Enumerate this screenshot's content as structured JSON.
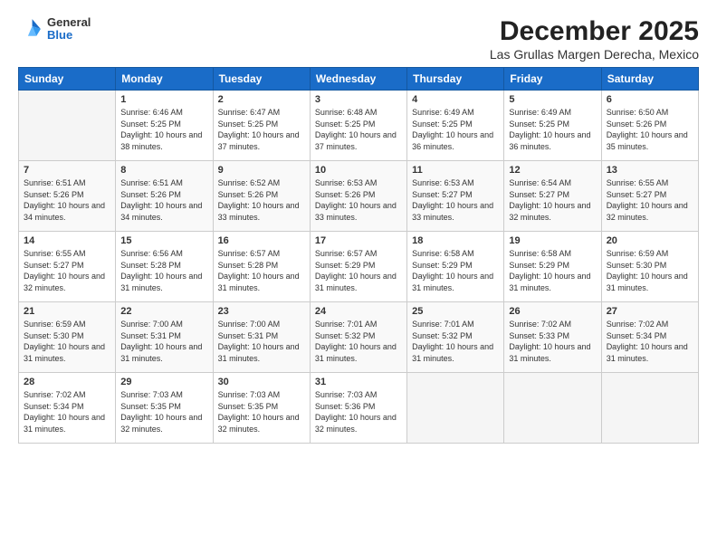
{
  "logo": {
    "general": "General",
    "blue": "Blue"
  },
  "title": "December 2025",
  "location": "Las Grullas Margen Derecha, Mexico",
  "days_header": [
    "Sunday",
    "Monday",
    "Tuesday",
    "Wednesday",
    "Thursday",
    "Friday",
    "Saturday"
  ],
  "weeks": [
    [
      {
        "day": "",
        "sunrise": "",
        "sunset": "",
        "daylight": ""
      },
      {
        "day": "1",
        "sunrise": "Sunrise: 6:46 AM",
        "sunset": "Sunset: 5:25 PM",
        "daylight": "Daylight: 10 hours and 38 minutes."
      },
      {
        "day": "2",
        "sunrise": "Sunrise: 6:47 AM",
        "sunset": "Sunset: 5:25 PM",
        "daylight": "Daylight: 10 hours and 37 minutes."
      },
      {
        "day": "3",
        "sunrise": "Sunrise: 6:48 AM",
        "sunset": "Sunset: 5:25 PM",
        "daylight": "Daylight: 10 hours and 37 minutes."
      },
      {
        "day": "4",
        "sunrise": "Sunrise: 6:49 AM",
        "sunset": "Sunset: 5:25 PM",
        "daylight": "Daylight: 10 hours and 36 minutes."
      },
      {
        "day": "5",
        "sunrise": "Sunrise: 6:49 AM",
        "sunset": "Sunset: 5:25 PM",
        "daylight": "Daylight: 10 hours and 36 minutes."
      },
      {
        "day": "6",
        "sunrise": "Sunrise: 6:50 AM",
        "sunset": "Sunset: 5:26 PM",
        "daylight": "Daylight: 10 hours and 35 minutes."
      }
    ],
    [
      {
        "day": "7",
        "sunrise": "Sunrise: 6:51 AM",
        "sunset": "Sunset: 5:26 PM",
        "daylight": "Daylight: 10 hours and 34 minutes."
      },
      {
        "day": "8",
        "sunrise": "Sunrise: 6:51 AM",
        "sunset": "Sunset: 5:26 PM",
        "daylight": "Daylight: 10 hours and 34 minutes."
      },
      {
        "day": "9",
        "sunrise": "Sunrise: 6:52 AM",
        "sunset": "Sunset: 5:26 PM",
        "daylight": "Daylight: 10 hours and 33 minutes."
      },
      {
        "day": "10",
        "sunrise": "Sunrise: 6:53 AM",
        "sunset": "Sunset: 5:26 PM",
        "daylight": "Daylight: 10 hours and 33 minutes."
      },
      {
        "day": "11",
        "sunrise": "Sunrise: 6:53 AM",
        "sunset": "Sunset: 5:27 PM",
        "daylight": "Daylight: 10 hours and 33 minutes."
      },
      {
        "day": "12",
        "sunrise": "Sunrise: 6:54 AM",
        "sunset": "Sunset: 5:27 PM",
        "daylight": "Daylight: 10 hours and 32 minutes."
      },
      {
        "day": "13",
        "sunrise": "Sunrise: 6:55 AM",
        "sunset": "Sunset: 5:27 PM",
        "daylight": "Daylight: 10 hours and 32 minutes."
      }
    ],
    [
      {
        "day": "14",
        "sunrise": "Sunrise: 6:55 AM",
        "sunset": "Sunset: 5:27 PM",
        "daylight": "Daylight: 10 hours and 32 minutes."
      },
      {
        "day": "15",
        "sunrise": "Sunrise: 6:56 AM",
        "sunset": "Sunset: 5:28 PM",
        "daylight": "Daylight: 10 hours and 31 minutes."
      },
      {
        "day": "16",
        "sunrise": "Sunrise: 6:57 AM",
        "sunset": "Sunset: 5:28 PM",
        "daylight": "Daylight: 10 hours and 31 minutes."
      },
      {
        "day": "17",
        "sunrise": "Sunrise: 6:57 AM",
        "sunset": "Sunset: 5:29 PM",
        "daylight": "Daylight: 10 hours and 31 minutes."
      },
      {
        "day": "18",
        "sunrise": "Sunrise: 6:58 AM",
        "sunset": "Sunset: 5:29 PM",
        "daylight": "Daylight: 10 hours and 31 minutes."
      },
      {
        "day": "19",
        "sunrise": "Sunrise: 6:58 AM",
        "sunset": "Sunset: 5:29 PM",
        "daylight": "Daylight: 10 hours and 31 minutes."
      },
      {
        "day": "20",
        "sunrise": "Sunrise: 6:59 AM",
        "sunset": "Sunset: 5:30 PM",
        "daylight": "Daylight: 10 hours and 31 minutes."
      }
    ],
    [
      {
        "day": "21",
        "sunrise": "Sunrise: 6:59 AM",
        "sunset": "Sunset: 5:30 PM",
        "daylight": "Daylight: 10 hours and 31 minutes."
      },
      {
        "day": "22",
        "sunrise": "Sunrise: 7:00 AM",
        "sunset": "Sunset: 5:31 PM",
        "daylight": "Daylight: 10 hours and 31 minutes."
      },
      {
        "day": "23",
        "sunrise": "Sunrise: 7:00 AM",
        "sunset": "Sunset: 5:31 PM",
        "daylight": "Daylight: 10 hours and 31 minutes."
      },
      {
        "day": "24",
        "sunrise": "Sunrise: 7:01 AM",
        "sunset": "Sunset: 5:32 PM",
        "daylight": "Daylight: 10 hours and 31 minutes."
      },
      {
        "day": "25",
        "sunrise": "Sunrise: 7:01 AM",
        "sunset": "Sunset: 5:32 PM",
        "daylight": "Daylight: 10 hours and 31 minutes."
      },
      {
        "day": "26",
        "sunrise": "Sunrise: 7:02 AM",
        "sunset": "Sunset: 5:33 PM",
        "daylight": "Daylight: 10 hours and 31 minutes."
      },
      {
        "day": "27",
        "sunrise": "Sunrise: 7:02 AM",
        "sunset": "Sunset: 5:34 PM",
        "daylight": "Daylight: 10 hours and 31 minutes."
      }
    ],
    [
      {
        "day": "28",
        "sunrise": "Sunrise: 7:02 AM",
        "sunset": "Sunset: 5:34 PM",
        "daylight": "Daylight: 10 hours and 31 minutes."
      },
      {
        "day": "29",
        "sunrise": "Sunrise: 7:03 AM",
        "sunset": "Sunset: 5:35 PM",
        "daylight": "Daylight: 10 hours and 32 minutes."
      },
      {
        "day": "30",
        "sunrise": "Sunrise: 7:03 AM",
        "sunset": "Sunset: 5:35 PM",
        "daylight": "Daylight: 10 hours and 32 minutes."
      },
      {
        "day": "31",
        "sunrise": "Sunrise: 7:03 AM",
        "sunset": "Sunset: 5:36 PM",
        "daylight": "Daylight: 10 hours and 32 minutes."
      },
      {
        "day": "",
        "sunrise": "",
        "sunset": "",
        "daylight": ""
      },
      {
        "day": "",
        "sunrise": "",
        "sunset": "",
        "daylight": ""
      },
      {
        "day": "",
        "sunrise": "",
        "sunset": "",
        "daylight": ""
      }
    ]
  ]
}
